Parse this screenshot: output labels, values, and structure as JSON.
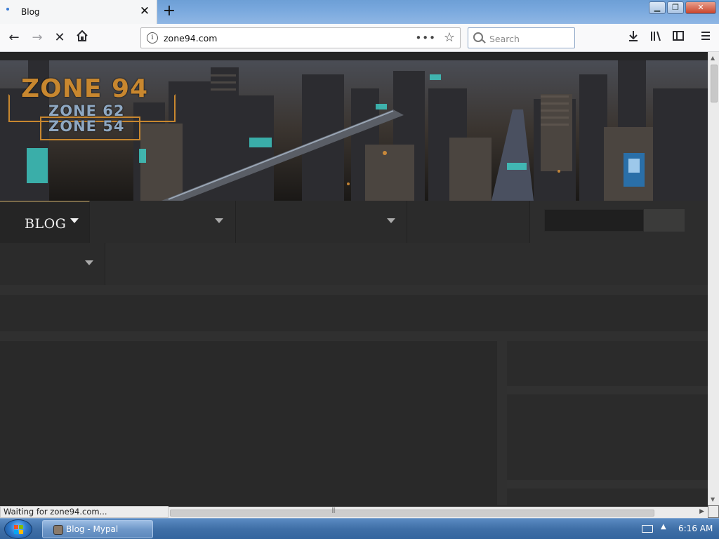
{
  "browser": {
    "tab_title": "Blog",
    "url": "zone94.com",
    "search_placeholder": "Search",
    "status_text": "Waiting for zone94.com..."
  },
  "site": {
    "logo_main": "ZONE 94",
    "logo_line2": "ZONE 62",
    "logo_line3": "ZONE 54",
    "nav_items": [
      {
        "label": "BLOG",
        "active": true
      },
      {
        "label": "",
        "active": false
      },
      {
        "label": "",
        "active": false
      },
      {
        "label": "",
        "active": false
      }
    ]
  },
  "taskbar": {
    "window_label": "Blog - Mypal",
    "clock": "6:16 AM"
  },
  "colors": {
    "page_bg": "#262626",
    "logo_orange": "#c8872f",
    "logo_blue": "#8fa8c2",
    "menu_bg": "#2d2d2d"
  }
}
